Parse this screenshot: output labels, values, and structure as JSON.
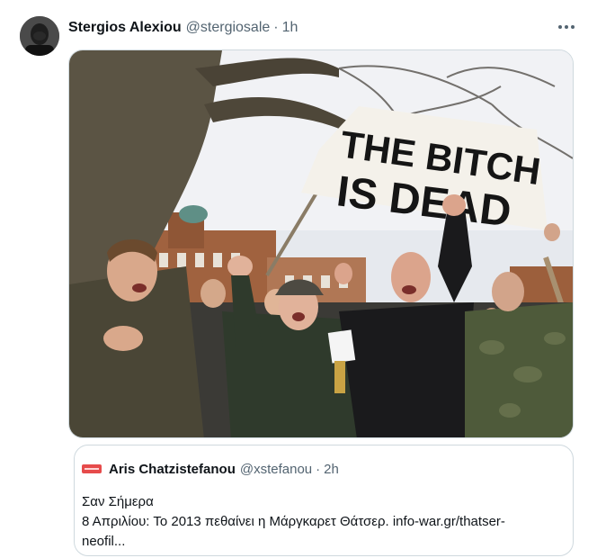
{
  "tweet": {
    "author_name": "Stergios Alexiou",
    "author_handle": "@stergiosale",
    "separator": "·",
    "time": "1h",
    "more_icon": "more-horizontal-icon",
    "media": {
      "sign_line1": "THE BITCH",
      "sign_line2": "IS DEAD"
    }
  },
  "quoted": {
    "author_name": "Aris Chatzistefanou",
    "author_handle": "@xstefanou",
    "separator": "·",
    "time": "2h",
    "text_line1": "Σαν Σήμερα",
    "text_line2": "8 Απριλίου: Το 2013 πεθαίνει η Μάργκαρετ Θάτσερ. info-war.gr/thatser-",
    "text_line3": "neofil..."
  },
  "colors": {
    "text_primary": "#0f1419",
    "text_secondary": "#536471",
    "border": "#cfd9de",
    "quoted_avatar": "#e64b4b"
  }
}
